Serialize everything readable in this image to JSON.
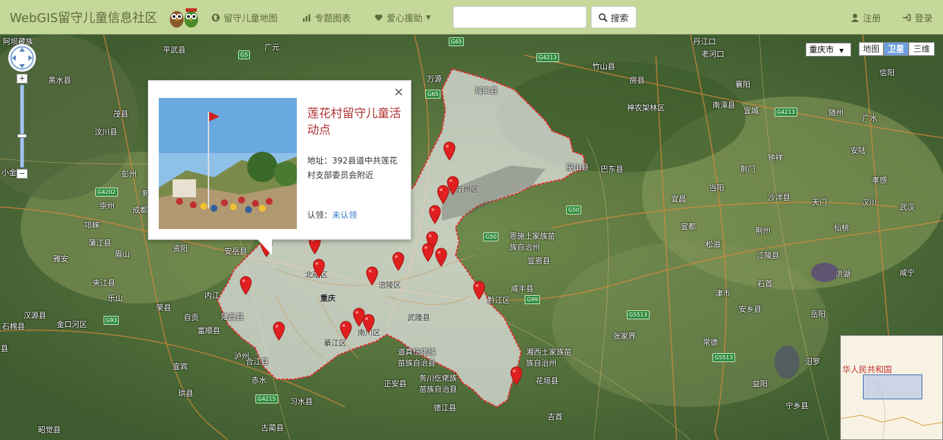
{
  "nav": {
    "brand": "WebGIS留守儿童信息社区",
    "links": [
      "留守儿童地图",
      "专题图表",
      "爱心援助"
    ],
    "search_placeholder": "",
    "search_button": "搜索",
    "register": "注册",
    "login": "登录"
  },
  "map": {
    "city_select": "重庆市",
    "map_types": [
      "地图",
      "卫星",
      "三维"
    ],
    "active_map_type": "卫星",
    "zoom_labels": [
      "+",
      "−"
    ],
    "side_label": "小金",
    "overview_label": "华人民共和国",
    "labels": [
      "阿坝藏族",
      "平武县",
      "广元",
      "万源",
      "城口县",
      "竹山县",
      "黑水县",
      "茂县",
      "汶川县",
      "小金",
      "彭州",
      "新都",
      "崇州",
      "成都",
      "邛崃",
      "蒲江县",
      "眉山",
      "雅安",
      "夹江县",
      "乐山",
      "资阳",
      "安岳县",
      "荣县",
      "自贡",
      "富顺县",
      "内江",
      "隆昌县",
      "泸州",
      "合江县",
      "宜宾",
      "金口河区",
      "汉源县",
      "石棉县",
      "珙县",
      "赤水",
      "习水县",
      "古蔺县",
      "昭觉县",
      "北碚区",
      "重庆",
      "涪陵区",
      "武隆县",
      "綦江区",
      "南川区",
      "万州区",
      "巫山县",
      "巴东县",
      "恩施土家族苗族自治州",
      "宣恩县",
      "咸丰县",
      "黔江区",
      "湘西土家族苗族自治州",
      "花垣县",
      "张家界",
      "吉首",
      "道真仡佬族苗族自治县",
      "务川仡佬族苗族自治县",
      "正安县",
      "德江县",
      "房县",
      "神农架林区",
      "南漳县",
      "襄阳",
      "宜城",
      "随州",
      "广水",
      "安陆",
      "钟祥",
      "荆门",
      "当阳",
      "宜昌",
      "宜都",
      "孝感",
      "沙洋县",
      "天门",
      "汉川",
      "武汉",
      "荆州",
      "仙桃",
      "松滋",
      "江陵县",
      "洪湖",
      "咸宁",
      "津市",
      "石首",
      "安乡县",
      "岳阳",
      "常德",
      "汨罗",
      "益阳",
      "宁乡县",
      "老河口",
      "丹江口",
      "信阳"
    ]
  },
  "popup": {
    "title": "莲花村留守儿童活动点",
    "address": "地址：392县道中共莲花村支部委员会附近",
    "claim_label": "认领：",
    "claim_status": "未认领",
    "close": "×"
  },
  "colors": {
    "navbar": "#c6d79a",
    "nav_text": "#5b6b3e",
    "boundary": "#e03030",
    "popup_title": "#b03030",
    "link": "#3377cc",
    "pin": "#e02020"
  },
  "icons": [
    "globe-icon",
    "bar-chart-icon",
    "heart-icon",
    "search-icon",
    "user-icon",
    "login-icon",
    "map-pin-icon"
  ]
}
